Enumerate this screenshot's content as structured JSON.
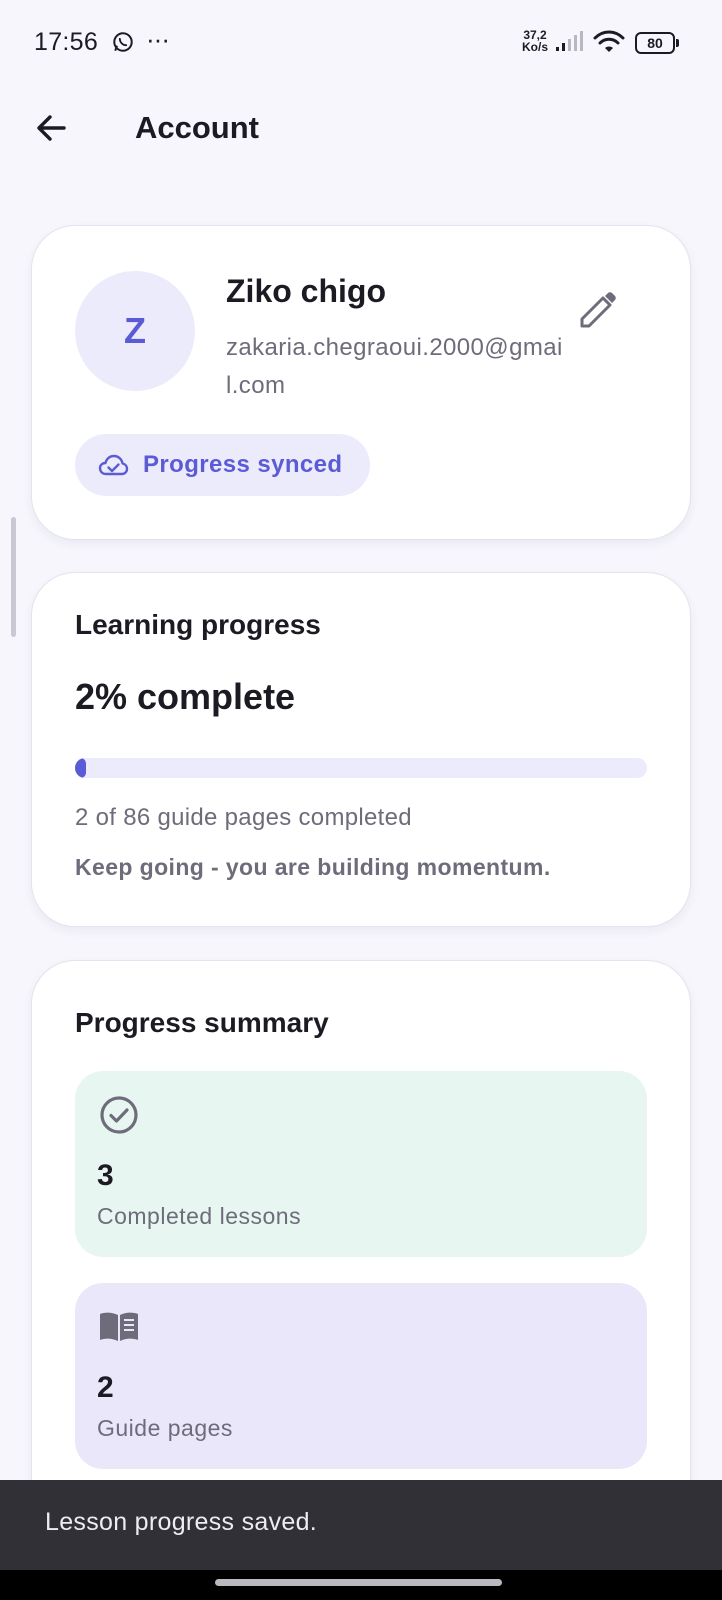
{
  "status_bar": {
    "time": "17:56",
    "more_dots": "···",
    "net_speed_value": "37,2",
    "net_speed_unit": "Ko/s",
    "battery": "80",
    "icons": [
      "whatsapp-icon",
      "signal-icon",
      "wifi-icon",
      "battery-icon"
    ]
  },
  "app_bar": {
    "title": "Account",
    "back_icon": "arrow-left-icon"
  },
  "profile": {
    "avatar_initial": "Z",
    "name": "Ziko chigo",
    "email": "zakaria.chegraoui.2000@gmail.com",
    "edit_icon": "pencil-icon",
    "sync_label": "Progress synced",
    "sync_icon": "cloud-check-icon"
  },
  "learning_progress": {
    "title": "Learning progress",
    "percent_label": "2% complete",
    "percent_value": 0.02,
    "pages_text": "2 of 86 guide pages completed",
    "message": "Keep going - you are building momentum."
  },
  "summary": {
    "title": "Progress summary",
    "stats": [
      {
        "value": "3",
        "label": "Completed lessons",
        "icon": "check-circle-icon"
      },
      {
        "value": "2",
        "label": "Guide pages",
        "icon": "book-icon"
      }
    ]
  },
  "snackbar": {
    "message": "Lesson progress saved."
  },
  "colors": {
    "accent": "#5b5bd6",
    "background": "#f6f6fc",
    "green_tile": "#e7f6f1",
    "purple_tile": "#ebe7fb"
  }
}
